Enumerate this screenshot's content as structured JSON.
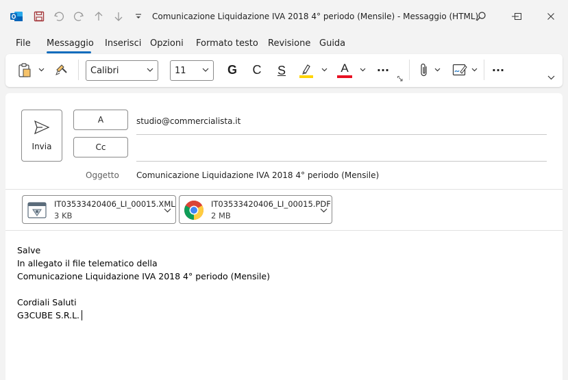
{
  "window": {
    "title": "Comunicazione Liquidazione IVA 2018 4° periodo  (Mensile)  -  Messaggio (HTML)",
    "icons": [
      "outlook-icon",
      "save-icon",
      "undo-icon",
      "redo-icon",
      "arrow-up-icon",
      "arrow-down-icon",
      "customize-icon",
      "search-icon",
      "minimize-icon",
      "maximize-icon",
      "close-icon"
    ]
  },
  "menu": {
    "items": [
      "File",
      "Messaggio",
      "Inserisci",
      "Opzioni",
      "Formato testo",
      "Revisione",
      "Guida"
    ],
    "active": "Messaggio",
    "accent": "#0f6cbd"
  },
  "ribbon": {
    "font_name": "Calibri",
    "font_size": "11",
    "bold": "G",
    "italic": "C",
    "underline": "S",
    "font_color_letter": "A",
    "more": "···",
    "highlight_color": "#ffd400",
    "font_color": "#e81123"
  },
  "compose": {
    "send_label": "Invia",
    "to_button": "A",
    "cc_button": "Cc",
    "to_value": "studio@commercialista.it",
    "cc_value": "",
    "subject_label": "Oggetto",
    "subject_value": "Comunicazione Liquidazione IVA 2018 4° periodo  (Mensile)"
  },
  "attachments": [
    {
      "name": "IT03533420406_LI_00015.XML",
      "size": "3 KB",
      "icon": "xml-file-icon"
    },
    {
      "name": "IT03533420406_LI_00015.PDF",
      "size": "2 MB",
      "icon": "chrome-icon"
    }
  ],
  "body": {
    "lines": [
      "Salve",
      "In allegato il file telematico della",
      "Comunicazione Liquidazione IVA 2018 4° periodo  (Mensile)",
      "",
      "Cordiali Saluti",
      "G3CUBE S.R.L."
    ]
  }
}
